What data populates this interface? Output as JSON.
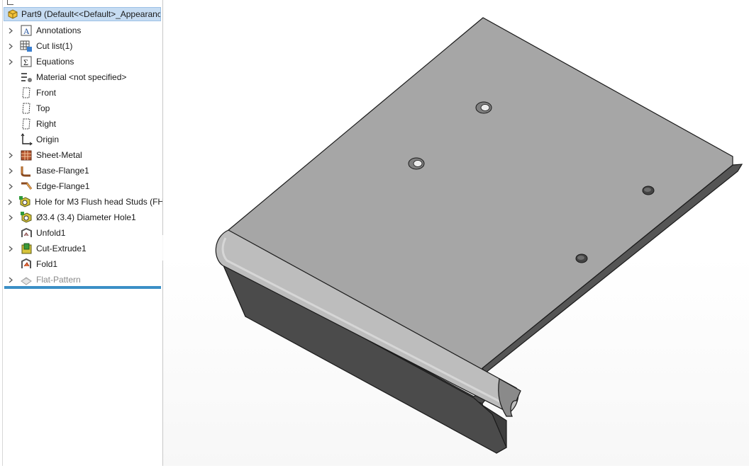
{
  "feature_tree": {
    "root": {
      "label": "Part9  (Default<<Default>_Appearance",
      "icon": "part-icon"
    },
    "items": [
      {
        "label": "Annotations",
        "icon": "annotations-icon",
        "expandable": true,
        "muted": false
      },
      {
        "label": "Cut list(1)",
        "icon": "cut-list-icon",
        "expandable": true,
        "muted": false
      },
      {
        "label": "Equations",
        "icon": "equations-icon",
        "expandable": true,
        "muted": false
      },
      {
        "label": "Material <not specified>",
        "icon": "material-icon",
        "expandable": false,
        "muted": false
      },
      {
        "label": "Front",
        "icon": "plane-icon",
        "expandable": false,
        "muted": false
      },
      {
        "label": "Top",
        "icon": "plane-icon",
        "expandable": false,
        "muted": false
      },
      {
        "label": "Right",
        "icon": "plane-icon",
        "expandable": false,
        "muted": false
      },
      {
        "label": "Origin",
        "icon": "origin-icon",
        "expandable": false,
        "muted": false
      },
      {
        "label": "Sheet-Metal",
        "icon": "sheet-metal-icon",
        "expandable": true,
        "muted": false
      },
      {
        "label": "Base-Flange1",
        "icon": "base-flange-icon",
        "expandable": true,
        "muted": false
      },
      {
        "label": "Edge-Flange1",
        "icon": "edge-flange-icon",
        "expandable": true,
        "muted": false
      },
      {
        "label": "Hole for M3 Flush head Studs (FH",
        "icon": "hole-wizard-icon",
        "expandable": true,
        "muted": false
      },
      {
        "label": "Ø3.4 (3.4) Diameter Hole1",
        "icon": "hole-wizard-icon",
        "expandable": true,
        "muted": false
      },
      {
        "label": "Unfold1",
        "icon": "unfold-icon",
        "expandable": false,
        "muted": false
      },
      {
        "label": "Cut-Extrude1",
        "icon": "cut-extrude-icon",
        "expandable": true,
        "muted": false
      },
      {
        "label": "Fold1",
        "icon": "fold-icon",
        "expandable": false,
        "muted": false
      },
      {
        "label": "Flat-Pattern",
        "icon": "flat-pattern-icon",
        "expandable": true,
        "muted": true
      }
    ]
  },
  "colors": {
    "selection": "#c6dcf2",
    "rollback_bar": "#3b8fc6",
    "part_top": "#a6a6a6",
    "part_side": "#4d4d4d",
    "part_edge": "#1a1a1a"
  }
}
